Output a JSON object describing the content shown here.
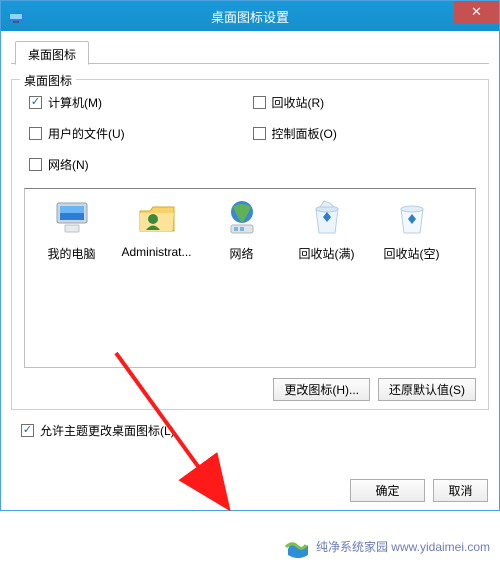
{
  "title": "桌面图标设置",
  "tab_label": "桌面图标",
  "group_title": "桌面图标",
  "checkboxes": {
    "computer": {
      "label": "计算机(M)",
      "checked": true
    },
    "recycle": {
      "label": "回收站(R)",
      "checked": false
    },
    "userfiles": {
      "label": "用户的文件(U)",
      "checked": false
    },
    "control": {
      "label": "控制面板(O)",
      "checked": false
    },
    "network": {
      "label": "网络(N)",
      "checked": false
    }
  },
  "icons": [
    {
      "label": "我的电脑",
      "type": "computer"
    },
    {
      "label": "Administrat...",
      "type": "userfolder"
    },
    {
      "label": "网络",
      "type": "network"
    },
    {
      "label": "回收站(满)",
      "type": "bin_full"
    },
    {
      "label": "回收站(空)",
      "type": "bin_empty"
    }
  ],
  "buttons": {
    "change_icon": "更改图标(H)...",
    "restore_default": "还原默认值(S)",
    "ok": "确定",
    "cancel": "取消"
  },
  "theme_checkbox": {
    "label": "允许主题更改桌面图标(L)",
    "checked": true
  },
  "watermark": "纯净系统家园  www.yidaimei.com"
}
